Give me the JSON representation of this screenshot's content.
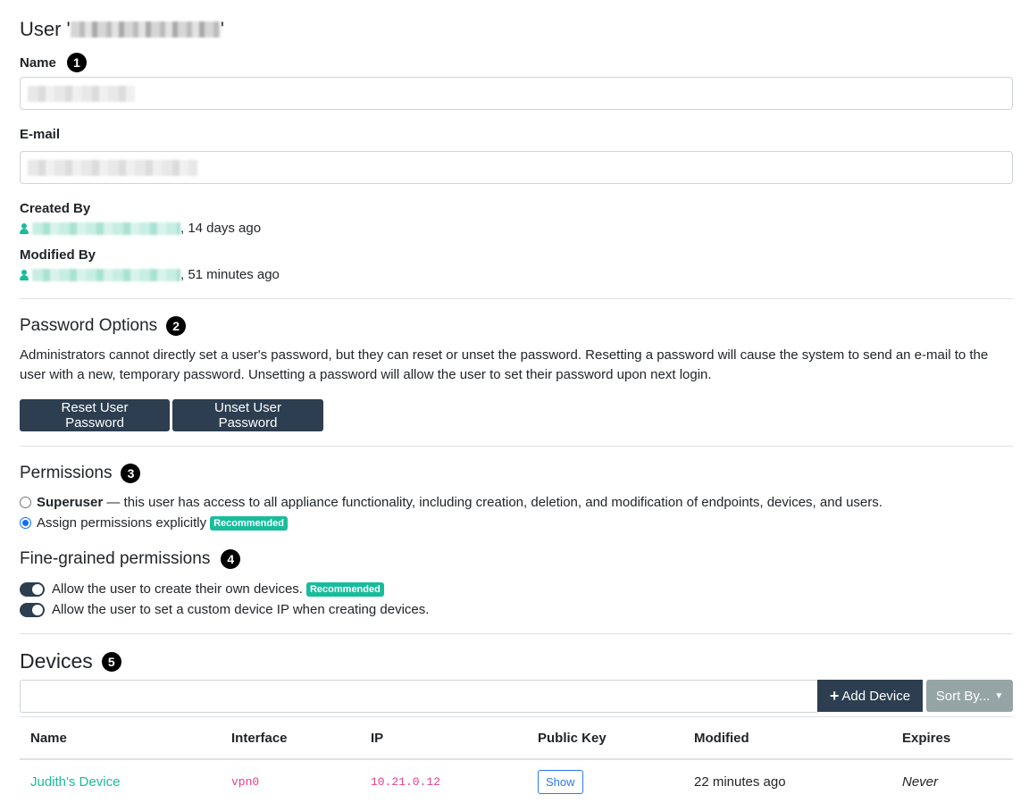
{
  "header": {
    "title_prefix": "User '",
    "title_suffix": "'"
  },
  "name_field": {
    "label": "Name",
    "marker": "1"
  },
  "email_field": {
    "label": "E-mail"
  },
  "created": {
    "label": "Created By",
    "when": ", 14 days ago"
  },
  "modified": {
    "label": "Modified By",
    "when": ", 51 minutes ago"
  },
  "password": {
    "title": "Password Options",
    "marker": "2",
    "description": "Administrators cannot directly set a user's password, but they can reset or unset the password. Resetting a password will cause the system to send an e-mail to the user with a new, temporary password. Unsetting a password will allow the user to set their password upon next login.",
    "reset_label": "Reset User Password",
    "unset_label": "Unset User Password"
  },
  "permissions": {
    "title": "Permissions",
    "marker": "3",
    "superuser_strong": "Superuser",
    "superuser_rest": " — this user has access to all appliance functionality, including creation, deletion, and modification of endpoints, devices, and users.",
    "explicit_label": "Assign permissions explicitly",
    "recommended": "Recommended"
  },
  "fine": {
    "title": "Fine-grained permissions",
    "marker": "4",
    "opt1": "Allow the user to create their own devices.",
    "opt2": "Allow the user to set a custom device IP when creating devices.",
    "recommended": "Recommended"
  },
  "devices": {
    "title": "Devices",
    "marker": "5",
    "add_label": "Add Device",
    "sort_label": "Sort By...",
    "columns": [
      "Name",
      "Interface",
      "IP",
      "Public Key",
      "Modified",
      "Expires"
    ],
    "rows": [
      {
        "name": "Judith's Device",
        "interface": "vpn0",
        "ip": "10.21.0.12",
        "key_button": "Show",
        "modified": "22 minutes ago",
        "expires": "Never"
      }
    ]
  },
  "colors": {
    "accent": "#18bc9c",
    "primary_dark": "#2c3e50",
    "code": "#e83e8c",
    "sort_bg": "#95a5a6"
  }
}
